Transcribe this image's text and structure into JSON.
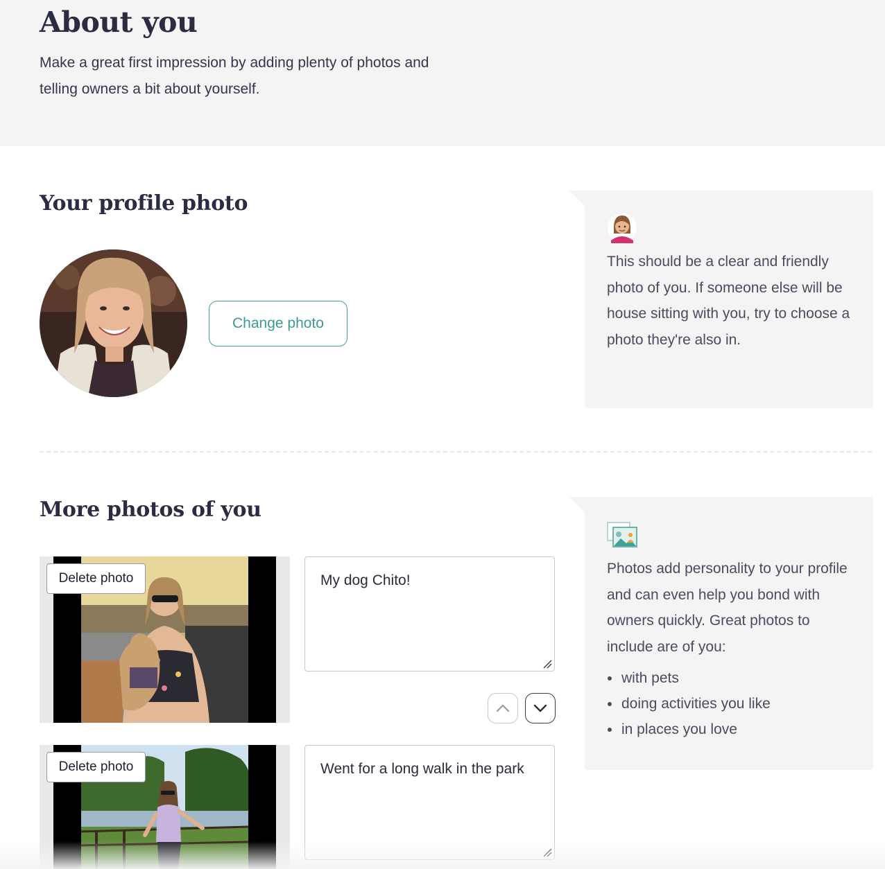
{
  "header": {
    "title": "About you",
    "intro_line1": "Make a great first impression by adding plenty of photos and",
    "intro_line2": "telling owners a bit about yourself."
  },
  "profile_photo": {
    "title": "Your profile photo",
    "change_label": "Change photo",
    "tip_text": "This should be a clear and friendly photo of you. If someone else will be house sitting with you, try to choose a photo they're also in.",
    "tip_icon": "sitter-avatar-icon"
  },
  "more_photos": {
    "title": "More photos of you",
    "tip_icon": "photos-icon",
    "tip_text": "Photos add personality to your profile and can even help you bond with owners quickly. Great photos to include are of you:",
    "tip_items": [
      "with pets",
      "doing activities you like",
      "in places you love"
    ],
    "delete_label": "Delete photo",
    "items": [
      {
        "caption": "My dog Chito!"
      },
      {
        "caption": "Went for a long walk in the park"
      }
    ]
  },
  "colors": {
    "accent": "#3ea199",
    "header_bg": "#f4f4f5",
    "text": "#2f3046"
  }
}
